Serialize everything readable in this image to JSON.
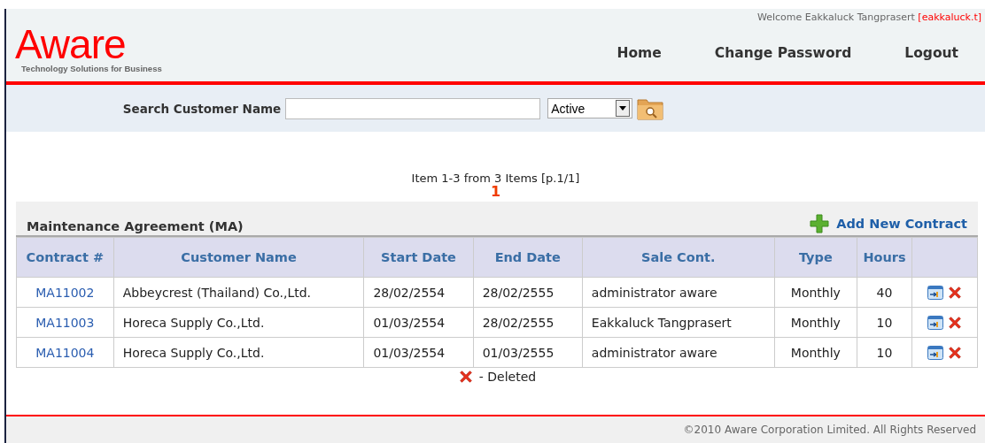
{
  "header": {
    "logo": {
      "name": "Aware",
      "tagline": "Technology Solutions for Business"
    },
    "welcome": "Welcome Eakkaluck Tangprasert",
    "username": "[eakkaluck.t]",
    "nav": [
      {
        "label": "Home"
      },
      {
        "label": "Change Password"
      },
      {
        "label": "Logout"
      }
    ]
  },
  "search": {
    "label": "Search Customer Name",
    "status": "Active"
  },
  "pager": {
    "summary": "Item 1-3 from 3 Items [p.1/1]",
    "pages": [
      "1"
    ]
  },
  "panel": {
    "title": "Maintenance Agreement (MA)",
    "add_label": "Add New Contract",
    "columns": [
      "Contract #",
      "Customer Name",
      "Start Date",
      "End Date",
      "Sale Cont.",
      "Type",
      "Hours"
    ],
    "rows": [
      {
        "contract": "MA11002",
        "customer": "Abbeycrest (Thailand) Co.,Ltd.",
        "start": "28/02/2554",
        "end": "28/02/2555",
        "sale": "administrator aware",
        "type": "Monthly",
        "hours": "40"
      },
      {
        "contract": "MA11003",
        "customer": "Horeca Supply Co.,Ltd.",
        "start": "01/03/2554",
        "end": "28/02/2555",
        "sale": "Eakkaluck Tangprasert",
        "type": "Monthly",
        "hours": "10"
      },
      {
        "contract": "MA11004",
        "customer": "Horeca Supply Co.,Ltd.",
        "start": "01/03/2554",
        "end": "01/03/2555",
        "sale": "administrator aware",
        "type": "Monthly",
        "hours": "10"
      }
    ],
    "legend": "- Deleted"
  },
  "footer": {
    "copyright": "©2010 Aware Corporation Limited. All Rights Reserved"
  }
}
